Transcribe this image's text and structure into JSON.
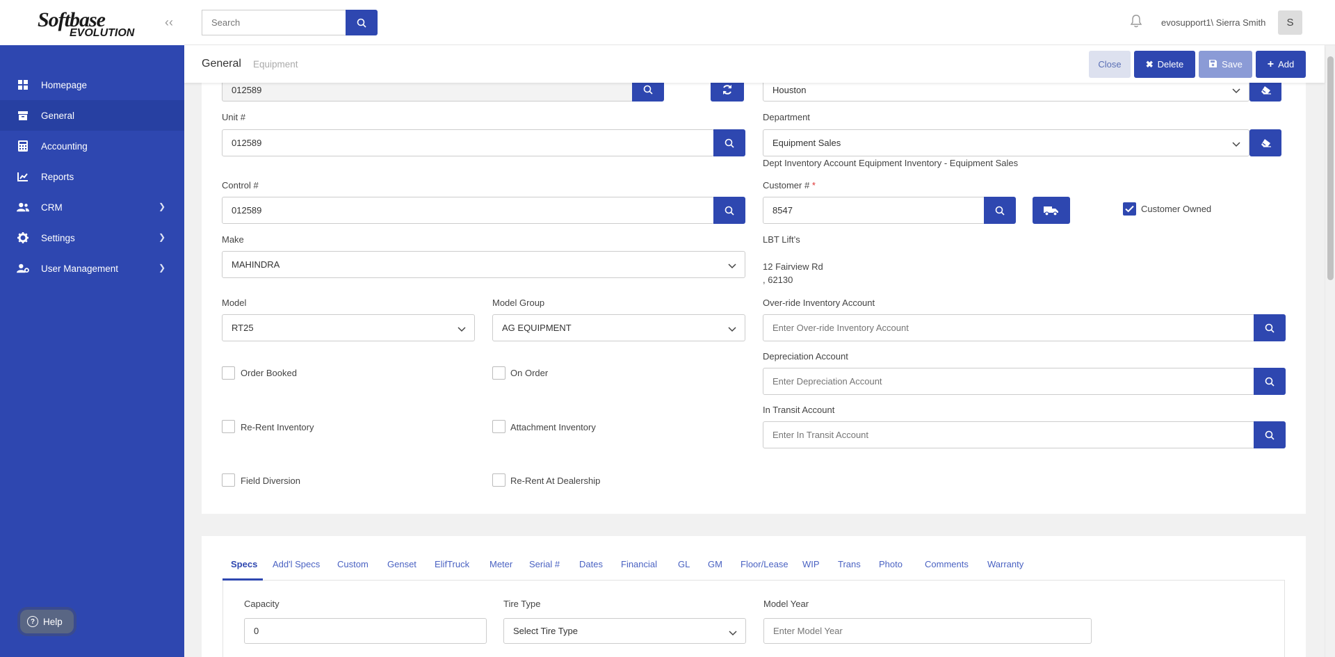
{
  "brand": {
    "line1": "Softbase",
    "line2": "EVOLUTION"
  },
  "sidebar": {
    "items": [
      {
        "label": "Homepage",
        "icon": "dashboard-icon"
      },
      {
        "label": "General",
        "icon": "archive-icon"
      },
      {
        "label": "Accounting",
        "icon": "calculator-icon"
      },
      {
        "label": "Reports",
        "icon": "chart-icon"
      },
      {
        "label": "CRM",
        "icon": "users-icon"
      },
      {
        "label": "Settings",
        "icon": "gear-icon"
      },
      {
        "label": "User Management",
        "icon": "user-gear-icon"
      }
    ],
    "help_label": "Help"
  },
  "topbar": {
    "search_placeholder": "Search",
    "user": "evosupport1\\ Sierra Smith",
    "avatar_initial": "S"
  },
  "subheader": {
    "title": "General",
    "subtitle": "Equipment",
    "close_label": "Close",
    "delete_label": "Delete",
    "save_label": "Save",
    "add_label": "Add"
  },
  "form": {
    "top_field_value": "012589",
    "branch_value": "Houston",
    "unit_label": "Unit #",
    "unit_value": "012589",
    "department_label": "Department",
    "department_value": "Equipment Sales",
    "dept_note": "Dept Inventory Account Equipment Inventory - Equipment Sales",
    "control_label": "Control #",
    "control_value": "012589",
    "customer_label": "Customer #",
    "customer_required": "*",
    "customer_value": "8547",
    "customer_owned_label": "Customer Owned",
    "make_label": "Make",
    "make_value": "MAHINDRA",
    "customer_name": "LBT Lift’s",
    "address_line1": "12 Fairview Rd",
    "address_line2": ", 62130",
    "model_label": "Model",
    "model_value": "RT25",
    "model_group_label": "Model Group",
    "model_group_value": "AG EQUIPMENT",
    "override_label": "Over-ride Inventory Account",
    "override_placeholder": "Enter Over-ride Inventory Account",
    "depreciation_label": "Depreciation Account",
    "depreciation_placeholder": "Enter Depreciation Account",
    "intransit_label": "In Transit Account",
    "intransit_placeholder": "Enter In Transit Account",
    "checkboxes": {
      "order_booked": "Order Booked",
      "on_order": "On Order",
      "rerent_inventory": "Re-Rent Inventory",
      "attachment_inventory": "Attachment Inventory",
      "field_diversion": "Field Diversion",
      "rerent_dealership": "Re-Rent At Dealership"
    }
  },
  "tabs": [
    "Specs",
    "Add'l Specs",
    "Custom",
    "Genset",
    "ElifTruck",
    "Meter",
    "Serial #",
    "Dates",
    "Financial",
    "GL",
    "GM",
    "Floor/Lease",
    "WIP",
    "Trans",
    "Photo",
    "Comments",
    "Warranty"
  ],
  "specs": {
    "capacity_label": "Capacity",
    "capacity_value": "0",
    "tire_type_label": "Tire Type",
    "tire_type_value": "Select Tire Type",
    "model_year_label": "Model Year",
    "model_year_placeholder": "Enter Model Year"
  },
  "colors": {
    "primary": "#2e47b0",
    "sidebar": "#2e47b0",
    "save_disabled": "#8b9bd6"
  }
}
